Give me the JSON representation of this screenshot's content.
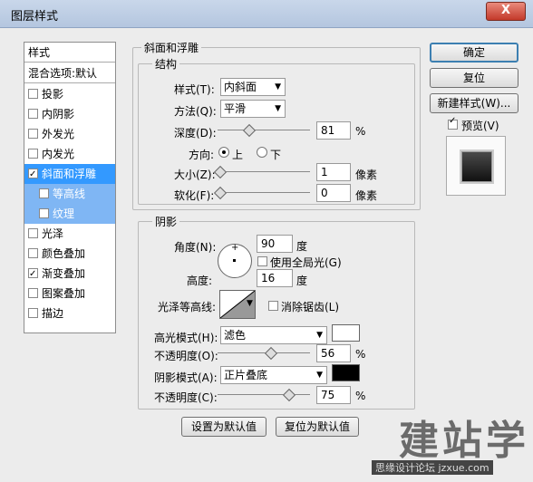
{
  "window": {
    "title": "图层样式",
    "close_label": "X"
  },
  "styles_list": {
    "header": "样式",
    "blend": "混合选项:默认",
    "items": [
      {
        "label": "投影",
        "checked": false
      },
      {
        "label": "内阴影",
        "checked": false
      },
      {
        "label": "外发光",
        "checked": false
      },
      {
        "label": "内发光",
        "checked": false
      },
      {
        "label": "斜面和浮雕",
        "checked": true
      },
      {
        "label": "等高线",
        "checked": false
      },
      {
        "label": "纹理",
        "checked": false
      },
      {
        "label": "光泽",
        "checked": false
      },
      {
        "label": "颜色叠加",
        "checked": false
      },
      {
        "label": "渐变叠加",
        "checked": true
      },
      {
        "label": "图案叠加",
        "checked": false
      },
      {
        "label": "描边",
        "checked": false
      }
    ]
  },
  "bevel": {
    "section_title": "斜面和浮雕",
    "structure_title": "结构",
    "style_label": "样式(T):",
    "style_value": "内斜面",
    "technique_label": "方法(Q):",
    "technique_value": "平滑",
    "depth_label": "深度(D):",
    "depth_value": "81",
    "percent": "%",
    "direction_label": "方向:",
    "dir_up": "上",
    "dir_down": "下",
    "size_label": "大小(Z):",
    "size_value": "1",
    "soften_label": "软化(F):",
    "soften_value": "0",
    "px_unit": "像素"
  },
  "shading": {
    "title": "阴影",
    "angle_label": "角度(N):",
    "angle_value": "90",
    "degree": "度",
    "global_light": "使用全局光(G)",
    "altitude_label": "高度:",
    "altitude_value": "16",
    "gloss_label": "光泽等高线:",
    "antialias": "消除锯齿(L)",
    "highlight_mode_label": "高光模式(H):",
    "highlight_mode": "滤色",
    "highlight_color": "#ffffff",
    "opacity_label_1": "不透明度(O):",
    "opacity_value_1": "56",
    "shadow_mode_label": "阴影模式(A):",
    "shadow_mode": "正片叠底",
    "shadow_color": "#000000",
    "opacity_label_2": "不透明度(C):",
    "opacity_value_2": "75",
    "percent": "%"
  },
  "buttons": {
    "set_default": "设置为默认值",
    "reset_default": "复位为默认值",
    "ok": "确定",
    "reset": "复位",
    "new_style": "新建样式(W)...",
    "preview": "预览(V)"
  },
  "watermark": {
    "big": "建站学",
    "small": "思缘设计论坛  jzxue.com"
  }
}
